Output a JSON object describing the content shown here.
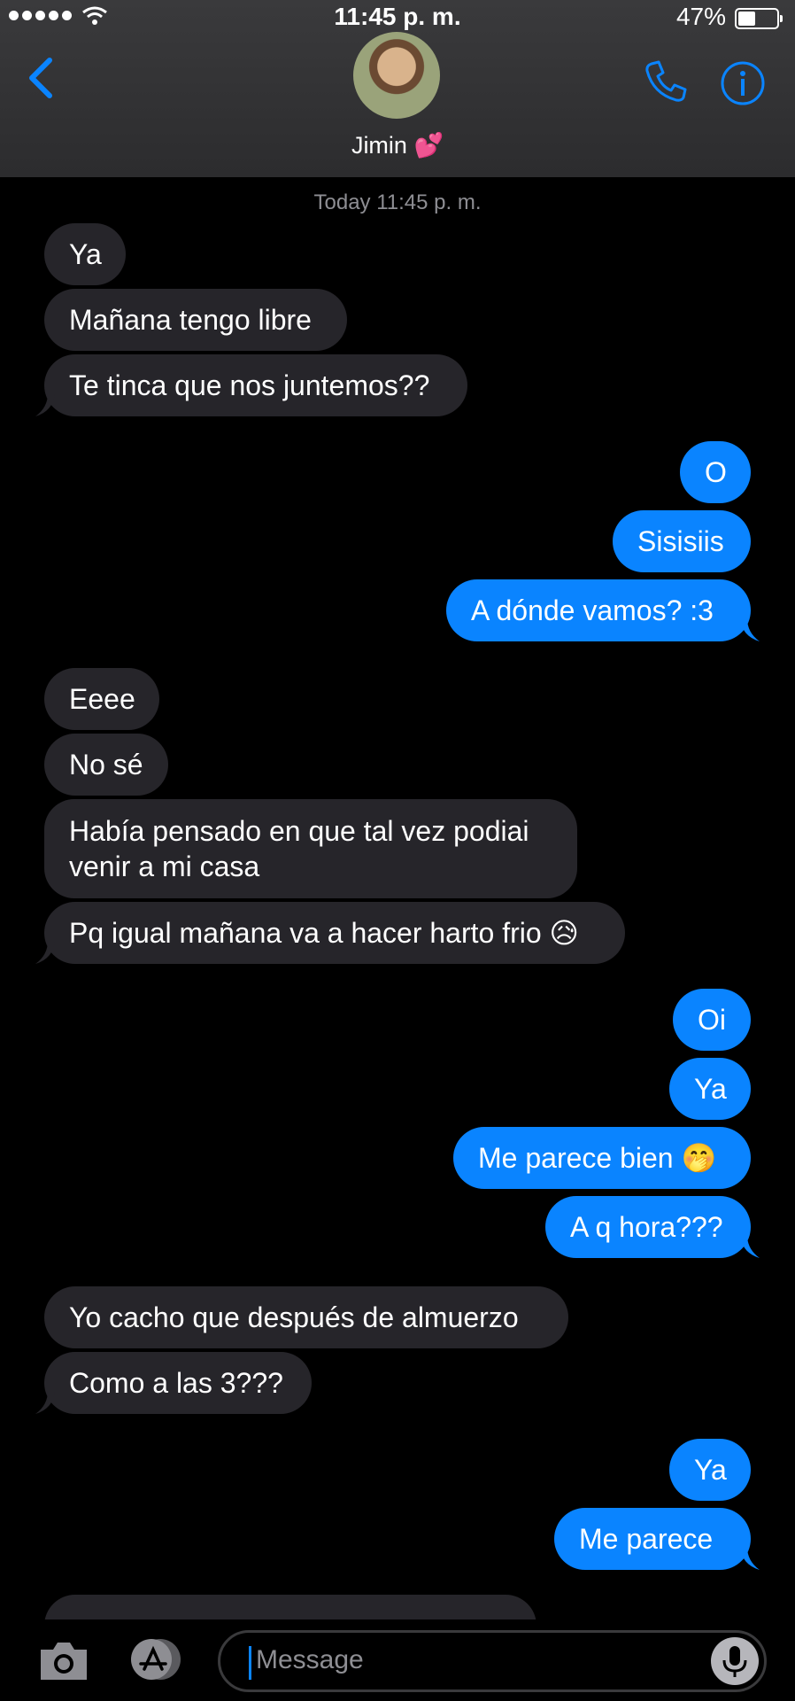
{
  "status": {
    "time": "11:45 p. m.",
    "battery": "47%",
    "battery_level": 0.47
  },
  "contact": {
    "name": "Jimin 💕"
  },
  "timestamp": "Today 11:45 p. m.",
  "messages": [
    "Ya",
    "Mañana tengo libre",
    "Te tinca que nos juntemos??",
    "O",
    "Sisisiis",
    "A dónde vamos? :3",
    "Eeee",
    "No sé",
    "Había pensado en que tal vez podiai venir a mi casa",
    "Pq igual mañana va a hacer harto frio 😥",
    "Oi",
    "Ya",
    "Me parece bien 🤭",
    "A q hora???",
    "Yo cacho que después de almuerzo",
    "Como a las 3???",
    "Ya",
    "Me parece"
  ],
  "composer": {
    "placeholder": "Message"
  },
  "colors": {
    "incoming": "#26252a",
    "outgoing": "#0a84ff",
    "accent": "#0a84ff",
    "background": "#000000"
  },
  "icons": [
    "back-chevron-icon",
    "phone-icon",
    "info-icon",
    "camera-icon",
    "app-store-icon",
    "microphone-icon",
    "wifi-icon"
  ]
}
